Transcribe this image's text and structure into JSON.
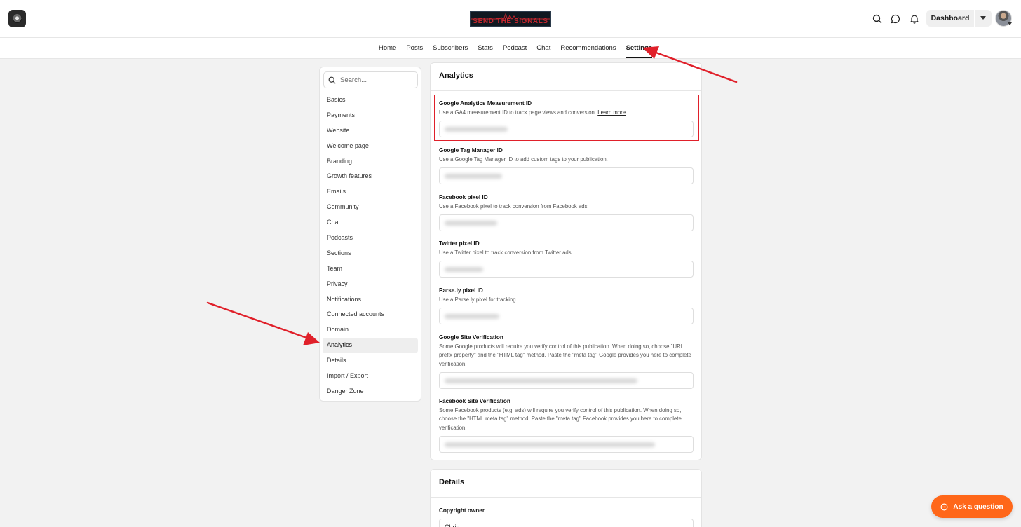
{
  "brand": {
    "name": "SEND THE SIGNALS"
  },
  "topbar": {
    "dashboard_label": "Dashboard"
  },
  "nav": {
    "tabs": [
      {
        "label": "Home"
      },
      {
        "label": "Posts"
      },
      {
        "label": "Subscribers"
      },
      {
        "label": "Stats"
      },
      {
        "label": "Podcast"
      },
      {
        "label": "Chat"
      },
      {
        "label": "Recommendations"
      },
      {
        "label": "Settings",
        "active": true
      }
    ]
  },
  "sidebar": {
    "search_placeholder": "Search...",
    "items": [
      "Basics",
      "Payments",
      "Website",
      "Welcome page",
      "Branding",
      "Growth features",
      "Emails",
      "Community",
      "Chat",
      "Podcasts",
      "Sections",
      "Team",
      "Privacy",
      "Notifications",
      "Connected accounts",
      "Domain",
      "Analytics",
      "Details",
      "Import / Export",
      "Danger Zone"
    ],
    "active_item": "Analytics"
  },
  "analytics": {
    "title": "Analytics",
    "fields": [
      {
        "label": "Google Analytics Measurement ID",
        "desc": "Use a GA4 measurement ID to track page views and conversion.",
        "link": "Learn more"
      },
      {
        "label": "Google Tag Manager ID",
        "desc": "Use a Google Tag Manager ID to add custom tags to your publication."
      },
      {
        "label": "Facebook pixel ID",
        "desc": "Use a Facebook pixel to track conversion from Facebook ads."
      },
      {
        "label": "Twitter pixel ID",
        "desc": "Use a Twitter pixel to track conversion from Twitter ads."
      },
      {
        "label": "Parse.ly pixel ID",
        "desc": "Use a Parse.ly pixel for tracking."
      },
      {
        "label": "Google Site Verification",
        "desc": "Some Google products will require you verify control of this publication. When doing so, choose \"URL prefix property\" and the \"HTML tag\" method. Paste the \"meta tag\" Google provides you here to complete verification."
      },
      {
        "label": "Facebook Site Verification",
        "desc": "Some Facebook products (e.g. ads) will require you verify control of this publication. When doing so, choose the \"HTML meta tag\" method. Paste the \"meta tag\" Facebook provides you here to complete verification."
      }
    ]
  },
  "details": {
    "title": "Details",
    "copyright_label": "Copyright owner",
    "copyright_value": "Chris"
  },
  "help": {
    "ask_label": "Ask a question"
  },
  "colors": {
    "accent": "#ff6719",
    "annotation": "#e0202a"
  }
}
